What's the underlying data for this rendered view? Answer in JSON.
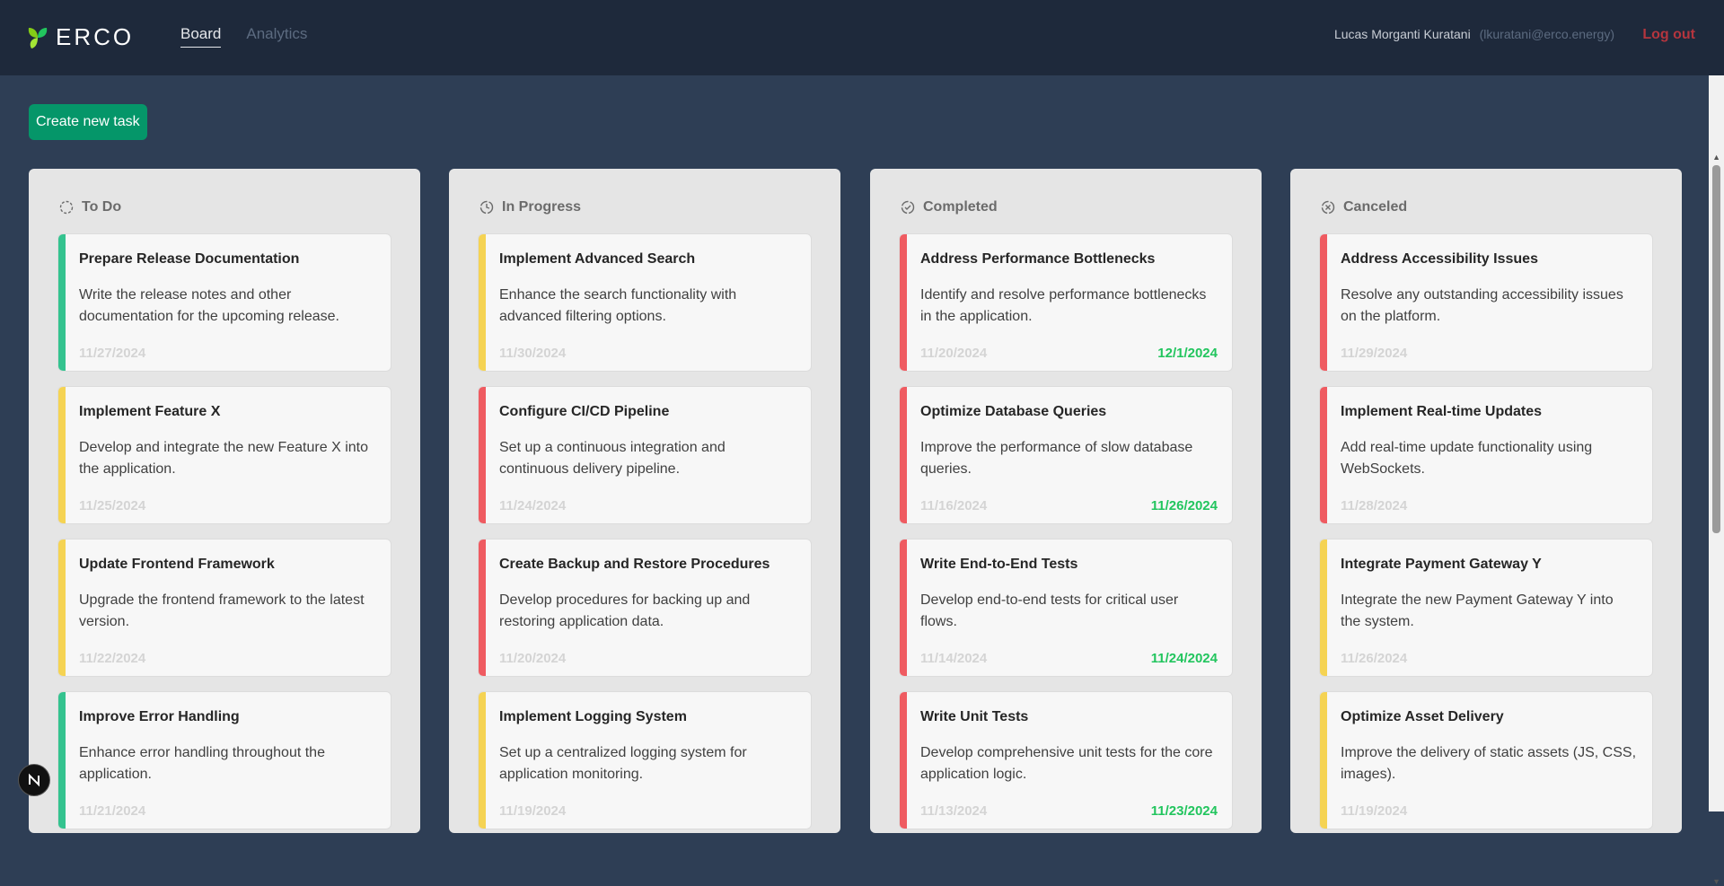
{
  "header": {
    "brand": "ERCO",
    "nav": [
      {
        "label": "Board"
      },
      {
        "label": "Analytics"
      }
    ],
    "user_name": "Lucas Morganti Kuratani",
    "user_email": "(lkuratani@erco.energy)",
    "logout_label": "Log out"
  },
  "toolbar": {
    "create_label": "Create new task"
  },
  "colors": {
    "green": "#34c38f",
    "yellow": "#f5d353",
    "red": "#ef5b61",
    "done_date": "#22c55e",
    "create_button": "#059669"
  },
  "columns": [
    {
      "title": "To Do",
      "icon": "dashed-circle-icon",
      "cards": [
        {
          "title": "Prepare Release Documentation",
          "desc": "Write the release notes and other documentation for the upcoming release.",
          "date": "11/27/2024",
          "priority": "green"
        },
        {
          "title": "Implement Feature X",
          "desc": "Develop and integrate the new Feature X into the application.",
          "date": "11/25/2024",
          "priority": "yellow"
        },
        {
          "title": "Update Frontend Framework",
          "desc": "Upgrade the frontend framework to the latest version.",
          "date": "11/22/2024",
          "priority": "yellow"
        },
        {
          "title": "Improve Error Handling",
          "desc": "Enhance error handling throughout the application.",
          "date": "11/21/2024",
          "priority": "green"
        }
      ]
    },
    {
      "title": "In Progress",
      "icon": "progress-circle-icon",
      "cards": [
        {
          "title": "Implement Advanced Search",
          "desc": "Enhance the search functionality with advanced filtering options.",
          "date": "11/30/2024",
          "priority": "yellow"
        },
        {
          "title": "Configure CI/CD Pipeline",
          "desc": "Set up a continuous integration and continuous delivery pipeline.",
          "date": "11/24/2024",
          "priority": "red"
        },
        {
          "title": "Create Backup and Restore Procedures",
          "desc": "Develop procedures for backing up and restoring application data.",
          "date": "11/20/2024",
          "priority": "red"
        },
        {
          "title": "Implement Logging System",
          "desc": "Set up a centralized logging system for application monitoring.",
          "date": "11/19/2024",
          "priority": "yellow"
        }
      ]
    },
    {
      "title": "Completed",
      "icon": "check-circle-icon",
      "cards": [
        {
          "title": "Address Performance Bottlenecks",
          "desc": "Identify and resolve performance bottlenecks in the application.",
          "date": "11/20/2024",
          "done": "12/1/2024",
          "priority": "red"
        },
        {
          "title": "Optimize Database Queries",
          "desc": "Improve the performance of slow database queries.",
          "date": "11/16/2024",
          "done": "11/26/2024",
          "priority": "red"
        },
        {
          "title": "Write End-to-End Tests",
          "desc": "Develop end-to-end tests for critical user flows.",
          "date": "11/14/2024",
          "done": "11/24/2024",
          "priority": "red"
        },
        {
          "title": "Write Unit Tests",
          "desc": "Develop comprehensive unit tests for the core application logic.",
          "date": "11/13/2024",
          "done": "11/23/2024",
          "priority": "red"
        }
      ]
    },
    {
      "title": "Canceled",
      "icon": "x-circle-icon",
      "cards": [
        {
          "title": "Address Accessibility Issues",
          "desc": "Resolve any outstanding accessibility issues on the platform.",
          "date": "11/29/2024",
          "priority": "red"
        },
        {
          "title": "Implement Real-time Updates",
          "desc": "Add real-time update functionality using WebSockets.",
          "date": "11/28/2024",
          "priority": "red"
        },
        {
          "title": "Integrate Payment Gateway Y",
          "desc": "Integrate the new Payment Gateway Y into the system.",
          "date": "11/26/2024",
          "priority": "yellow"
        },
        {
          "title": "Optimize Asset Delivery",
          "desc": "Improve the delivery of static assets (JS, CSS, images).",
          "date": "11/19/2024",
          "priority": "yellow"
        }
      ]
    }
  ],
  "dev_badge": "N"
}
